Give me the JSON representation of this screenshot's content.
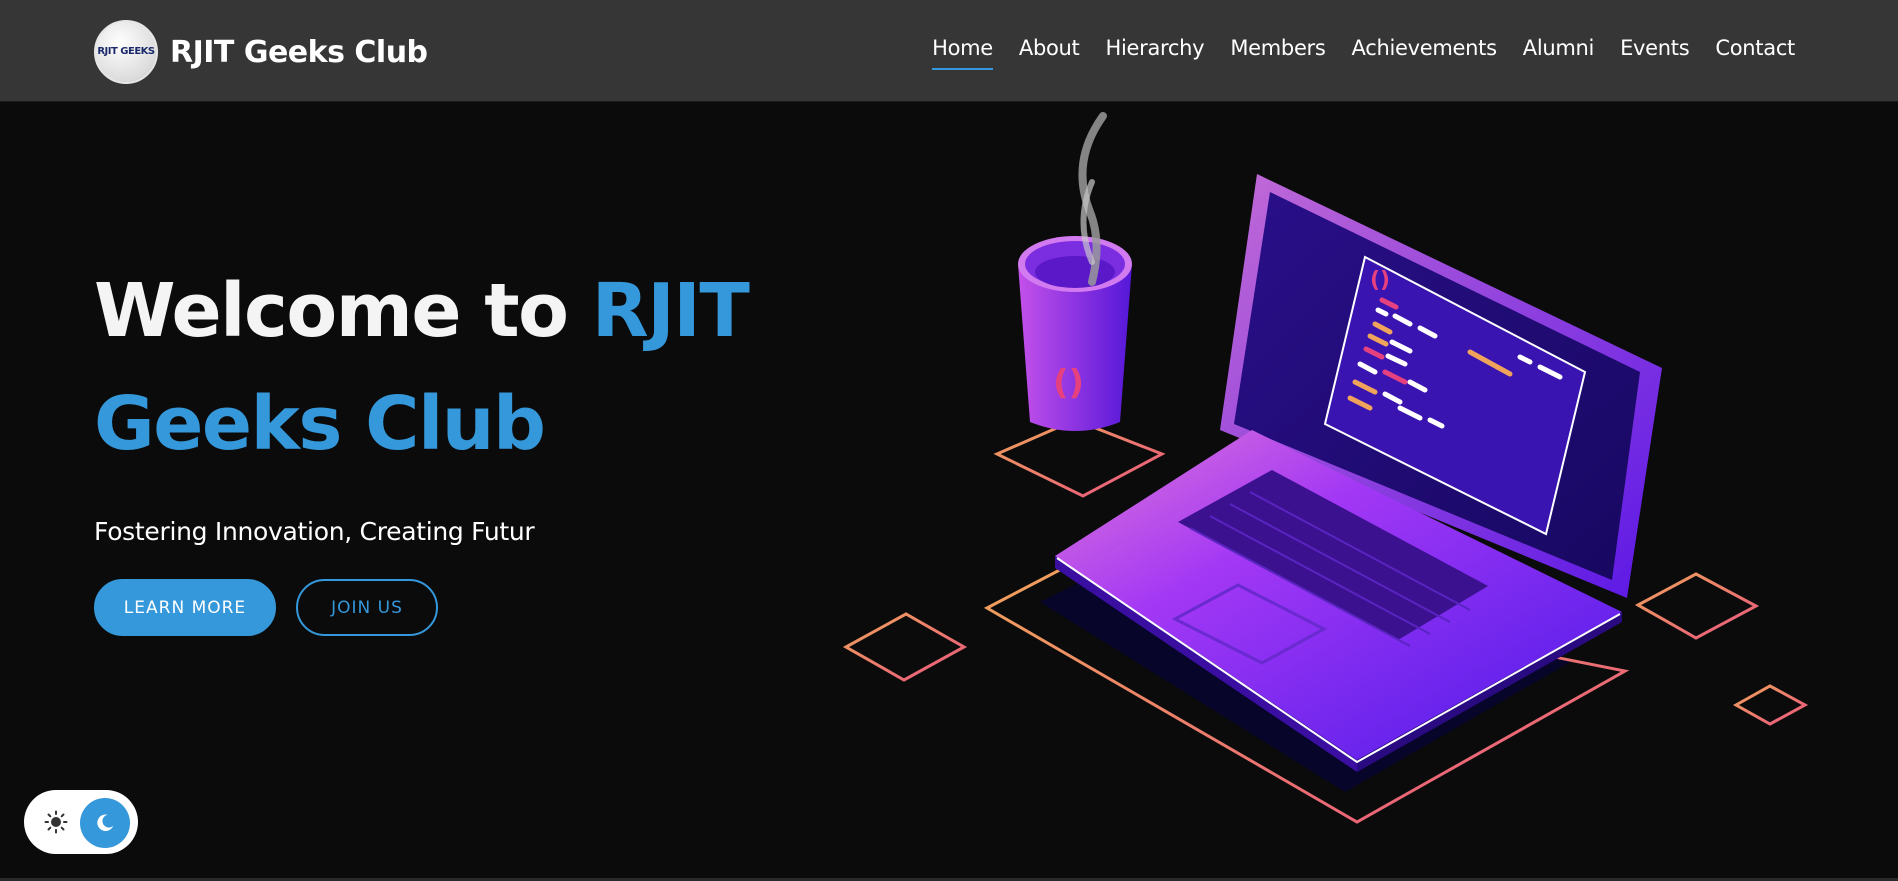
{
  "brand": {
    "logo_text": "RJIT GEEKS",
    "name": "RJIT Geeks Club"
  },
  "nav": {
    "items": [
      {
        "label": "Home",
        "active": true
      },
      {
        "label": "About",
        "active": false
      },
      {
        "label": "Hierarchy",
        "active": false
      },
      {
        "label": "Members",
        "active": false
      },
      {
        "label": "Achievements",
        "active": false
      },
      {
        "label": "Alumni",
        "active": false
      },
      {
        "label": "Events",
        "active": false
      },
      {
        "label": "Contact",
        "active": false
      }
    ]
  },
  "hero": {
    "title_prefix": "Welcome to ",
    "title_accent_1": "RJIT",
    "title_accent_2": "Geeks Club",
    "tagline": "Fostering Innovation, Creating Futur",
    "learn_more_label": "LEARN MORE",
    "join_us_label": "JOIN US"
  },
  "theme_toggle": {
    "light_icon": "sun-icon",
    "dark_icon": "moon-icon",
    "mode": "dark"
  },
  "colors": {
    "accent": "#3498db",
    "nav_bg": "#363636",
    "page_bg": "#0b0b0b"
  }
}
